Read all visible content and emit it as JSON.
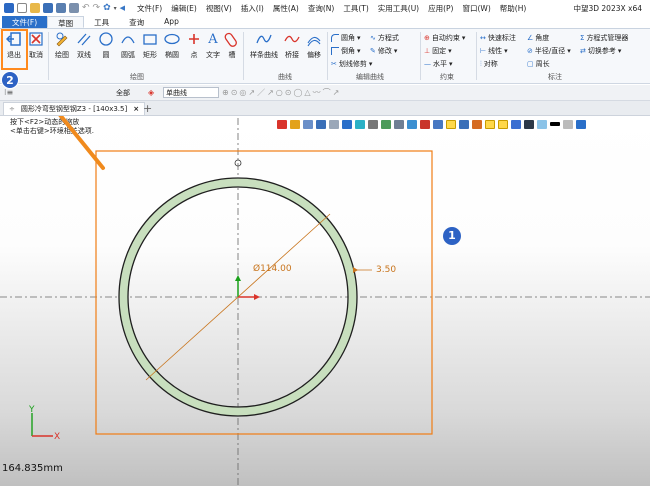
{
  "titlebar": {
    "menu": [
      "文件(F)",
      "编辑(E)",
      "视图(V)",
      "插入(I)",
      "属性(A)",
      "查询(N)",
      "工具(T)",
      "实用工具(U)",
      "应用(P)",
      "窗口(W)",
      "帮助(H)"
    ],
    "app_title": "中望3D 2023X x64"
  },
  "ribbon_tabs": [
    "文件(F)",
    "草图",
    "工具",
    "查询",
    "App"
  ],
  "ribbon": {
    "exit": "退出",
    "cancel": "取消",
    "draw": "绘图",
    "double_line": "双线",
    "circle": "圆",
    "arc": "圆弧",
    "rect": "矩形",
    "ellipse": "椭圆",
    "point": "点",
    "text": "文字",
    "slot": "槽",
    "group_draw": "绘图",
    "spline": "样条曲线",
    "bridge": "桥接",
    "offset": "偏移",
    "group_curve": "曲线",
    "fillet": "圆角",
    "chamfer": "倒角",
    "trim": "划线修剪",
    "equation": "方程式",
    "modify": "修改",
    "group_edit": "编辑曲线",
    "auto_constraint": "自动约束",
    "fix": "固定",
    "horizontal": "水平",
    "group_constraint": "约束",
    "quick_dim": "快速标注",
    "linear": "线性",
    "symmetric": "对称",
    "angle": "角度",
    "radius_dia": "半径/直径",
    "perimeter": "周长",
    "group_dim": "标注",
    "eq_manager": "方程式管理器",
    "toggle_ref": "切换参考"
  },
  "toolbar2": {
    "filter": "全部",
    "layer": "单曲线"
  },
  "document_tab": "圆形冷弯型钢型钢Z3 - [140x3.5]",
  "hints": {
    "line1": "按下<F2>动态的缩放",
    "line2": "<单击右键>环境相关选项."
  },
  "dimensions": {
    "diameter": "Ø114.00",
    "thickness": "3.50"
  },
  "status": "164.835mm",
  "badges": {
    "one": "1",
    "two": "2"
  },
  "colors": {
    "accent": "#2a6fc9",
    "highlight": "#ff8a1e",
    "ring_fill": "#c8dfbe",
    "dim": "#c8741c"
  }
}
